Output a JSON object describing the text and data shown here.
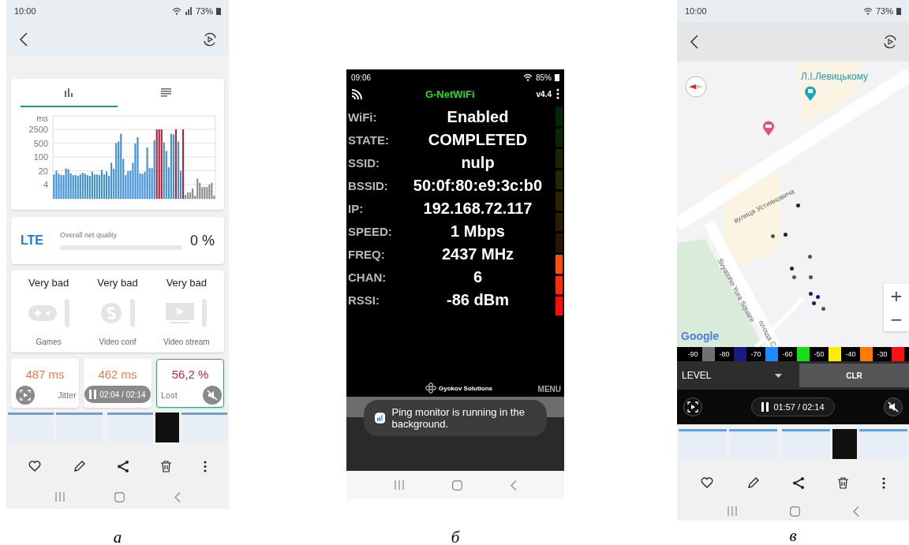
{
  "ping_monitor": {
    "caption": "а",
    "status_bar": {
      "time": "10:00",
      "battery": "73%"
    },
    "tabs": [
      {
        "kind": "chart",
        "selected": true
      },
      {
        "kind": "list",
        "selected": false
      }
    ],
    "ping_chart": {
      "unit": "ms",
      "y_labels": [
        "2500",
        "500",
        "100",
        "20",
        "4"
      ]
    },
    "quality": {
      "network": "LTE",
      "label": "Overall net quality",
      "level": 0,
      "value": "0 %"
    },
    "usage": [
      {
        "kind": "games",
        "rating": "Very bad",
        "label": "Games",
        "level": 0
      },
      {
        "kind": "video_conf",
        "rating": "Very bad",
        "label": "Video conf",
        "level": 0
      },
      {
        "kind": "video_stream",
        "rating": "Very bad",
        "label": "Video stream",
        "level": 0
      }
    ],
    "stats": [
      {
        "value": "487 ms",
        "label": "Jitter",
        "color": "#f0794f",
        "selected": false
      },
      {
        "value": "462 ms",
        "color": "#f0794f",
        "selected": false
      },
      {
        "value": "56,2 %",
        "label": "Lost",
        "color": "#b8284a",
        "selected": true
      }
    ],
    "player": {
      "time": "02:04 / 02:14"
    }
  },
  "wifi_info": {
    "caption": "б",
    "status_bar": {
      "time": "09:06",
      "battery": "85%"
    },
    "app": {
      "title": "G-NetWiFi",
      "version": "v4.4"
    },
    "rows": [
      {
        "label": "WiFi:",
        "value": "Enabled"
      },
      {
        "label": "STATE:",
        "value": "COMPLETED"
      },
      {
        "label": "SSID:",
        "value": "nulp"
      },
      {
        "label": "BSSID:",
        "value": "50:0f:80:e9:3c:b0"
      },
      {
        "label": "IP:",
        "value": "192.168.72.117"
      },
      {
        "label": "SPEED:",
        "value": "1 Mbps"
      },
      {
        "label": "FREQ:",
        "value": "2437 MHz"
      },
      {
        "label": "CHAN:",
        "value": "6"
      },
      {
        "label": "RSSI:",
        "value": "-86 dBm"
      }
    ],
    "signal_meter": {
      "level": 0.3
    },
    "footer": {
      "brand": "Gyokov Solutions",
      "menu": "MENU"
    },
    "toast": "Ping monitor is running in the background."
  },
  "wifi_map": {
    "caption": "в",
    "status_bar": {
      "time": "10:00",
      "battery": "73%"
    },
    "map": {
      "labels": [
        {
          "kind": "poi",
          "text": "Л.І.Левицькому"
        },
        {
          "kind": "street",
          "text": "вулиця Устияновича"
        },
        {
          "kind": "square",
          "text": "Svyatoho Yura Square"
        },
        {
          "kind": "square_local",
          "text": "площа С"
        }
      ],
      "points": [
        {
          "color": "#222222"
        },
        {
          "color": "#555555"
        },
        {
          "color": "#222222"
        },
        {
          "color": "#555555"
        },
        {
          "color": "#222222"
        },
        {
          "color": "#555555"
        },
        {
          "color": "#555555"
        },
        {
          "color": "#1a1a70"
        },
        {
          "color": "#1a1a70"
        },
        {
          "color": "#1a1a70"
        },
        {
          "color": "#555555"
        }
      ],
      "attribution": "Google",
      "zoom_in": "+",
      "zoom_out": "−"
    },
    "legend": [
      {
        "label": "-90",
        "color": "#707070"
      },
      {
        "label": "-80",
        "color": "#1a1a80"
      },
      {
        "label": "-70",
        "color": "#1e88ff"
      },
      {
        "label": "-60",
        "color": "#12e012"
      },
      {
        "label": "-50",
        "color": "#ffee00"
      },
      {
        "label": "-40",
        "color": "#ff7a00"
      },
      {
        "label": "-30",
        "color": "#ff1010"
      }
    ],
    "mode": "LEVEL",
    "clear": "CLR",
    "player": {
      "time": "01:57 / 02:14"
    }
  }
}
